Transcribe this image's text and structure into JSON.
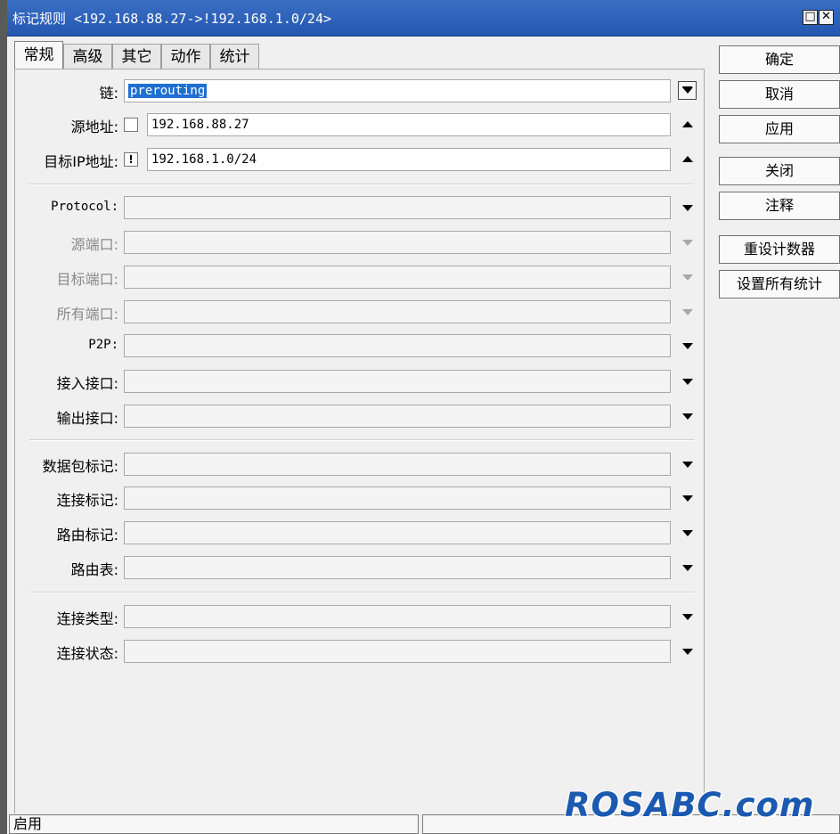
{
  "window": {
    "title": "标记规则 <192.168.88.27->!192.168.1.0/24>",
    "title_buttons": [
      "□",
      "✕"
    ]
  },
  "tabs": [
    {
      "label": "常规",
      "active": true
    },
    {
      "label": "高级"
    },
    {
      "label": "其它"
    },
    {
      "label": "动作"
    },
    {
      "label": "统计"
    }
  ],
  "fields": {
    "chain": {
      "label": "链:",
      "value": "prerouting"
    },
    "src_address": {
      "label": "源地址:",
      "value": "192.168.88.27",
      "negate": ""
    },
    "dst_address": {
      "label": "目标IP地址:",
      "value": "192.168.1.0/24",
      "negate": "!"
    },
    "protocol": {
      "label": "Protocol:"
    },
    "src_port": {
      "label": "源端口:"
    },
    "dst_port": {
      "label": "目标端口:"
    },
    "any_port": {
      "label": "所有端口:"
    },
    "p2p": {
      "label": "P2P:"
    },
    "in_interface": {
      "label": "接入接口:"
    },
    "out_interface": {
      "label": "输出接口:"
    },
    "packet_mark": {
      "label": "数据包标记:"
    },
    "connection_mark": {
      "label": "连接标记:"
    },
    "routing_mark": {
      "label": "路由标记:"
    },
    "routing_table": {
      "label": "路由表:"
    },
    "connection_type": {
      "label": "连接类型:"
    },
    "connection_state": {
      "label": "连接状态:"
    }
  },
  "buttons": {
    "ok": "确定",
    "cancel": "取消",
    "apply": "应用",
    "close": "关闭",
    "comment": "注释",
    "reset_counters": "重设计数器",
    "reset_all_counters": "设置所有统计"
  },
  "status": {
    "left": "启用",
    "right": ""
  },
  "watermark": "ROSABC.com",
  "colors": {
    "titlebar": "#2f65bd",
    "selection": "#1f6fd0",
    "watermark": "#1a5ab0"
  }
}
